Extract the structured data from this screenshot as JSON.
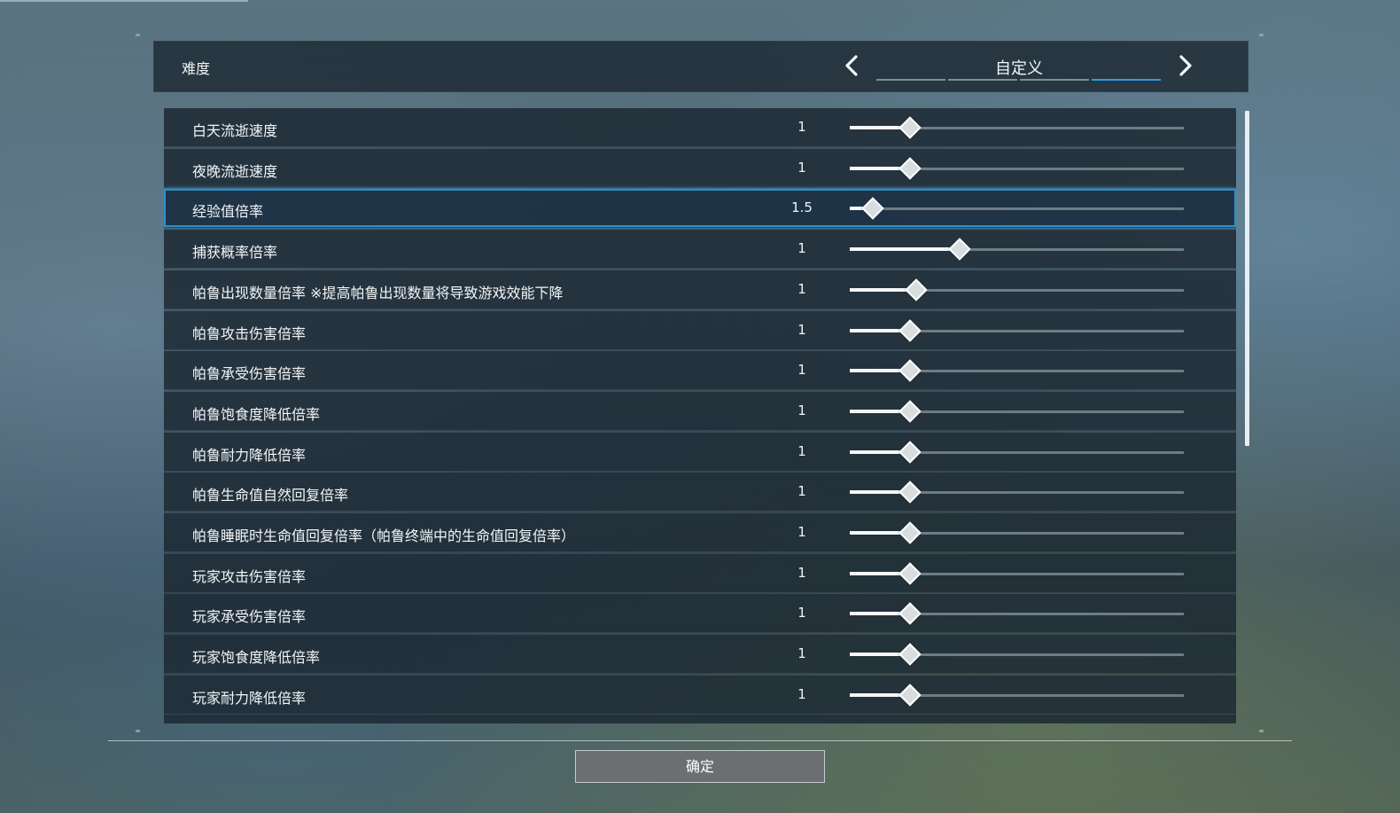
{
  "difficulty": {
    "label": "难度",
    "value": "自定义",
    "segments": 4,
    "active_segment": 3
  },
  "settings": [
    {
      "label": "白天流逝速度",
      "value": "1",
      "level": 0.18
    },
    {
      "label": "夜晚流逝速度",
      "value": "1",
      "level": 0.18
    },
    {
      "label": "经验值倍率",
      "value": "1.5",
      "level": 0.07,
      "selected": true
    },
    {
      "label": "捕获概率倍率",
      "value": "1",
      "level": 0.33
    },
    {
      "label": "帕鲁出现数量倍率 ※提高帕鲁出现数量将导致游戏效能下降",
      "value": "1",
      "level": 0.2
    },
    {
      "label": "帕鲁攻击伤害倍率",
      "value": "1",
      "level": 0.18
    },
    {
      "label": "帕鲁承受伤害倍率",
      "value": "1",
      "level": 0.18
    },
    {
      "label": "帕鲁饱食度降低倍率",
      "value": "1",
      "level": 0.18
    },
    {
      "label": "帕鲁耐力降低倍率",
      "value": "1",
      "level": 0.18
    },
    {
      "label": "帕鲁生命值自然回复倍率",
      "value": "1",
      "level": 0.18
    },
    {
      "label": "帕鲁睡眠时生命值回复倍率（帕鲁终端中的生命值回复倍率）",
      "value": "1",
      "level": 0.18
    },
    {
      "label": "玩家攻击伤害倍率",
      "value": "1",
      "level": 0.18
    },
    {
      "label": "玩家承受伤害倍率",
      "value": "1",
      "level": 0.18
    },
    {
      "label": "玩家饱食度降低倍率",
      "value": "1",
      "level": 0.18
    },
    {
      "label": "玩家耐力降低倍率",
      "value": "1",
      "level": 0.18
    }
  ],
  "confirm_label": "确定",
  "colors": {
    "accent": "#2a9de0",
    "row_bg": "#1e2a34",
    "button_bg": "#6b6f72"
  },
  "icons": {
    "prev": "chevron-left-icon",
    "next": "chevron-right-icon"
  }
}
